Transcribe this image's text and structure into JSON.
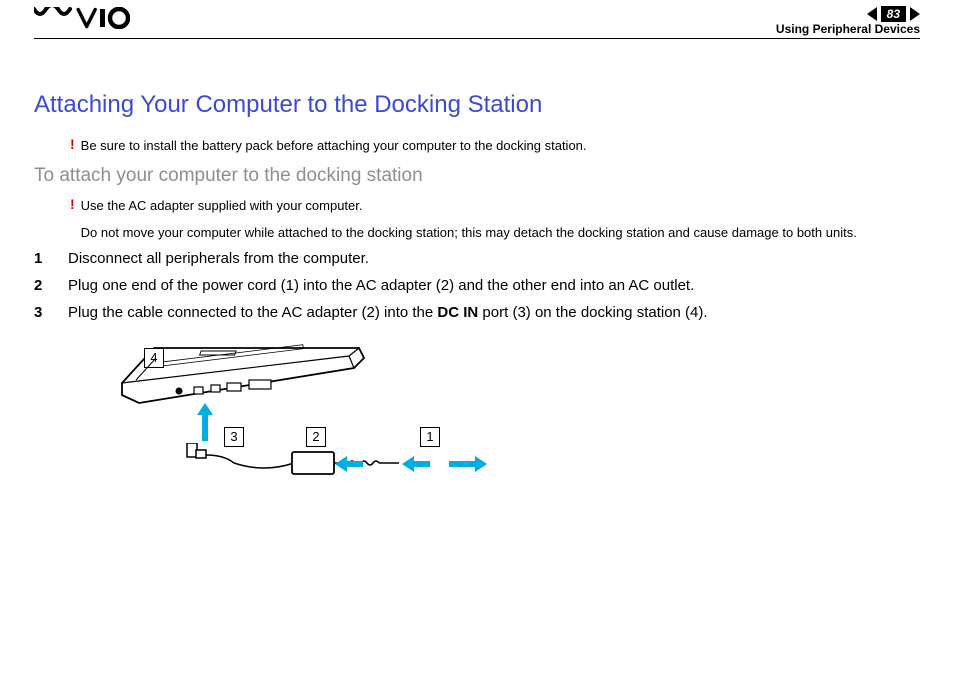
{
  "header": {
    "page_number": "83",
    "breadcrumb": "Using Peripheral Devices"
  },
  "title": "Attaching Your Computer to the Docking Station",
  "warn1": "Be sure to install the battery pack before attaching your computer to the docking station.",
  "subtitle": "To attach your computer to the docking station",
  "warn2_line1": "Use the AC adapter supplied with your computer.",
  "warn2_line2": "Do not move your computer while attached to the docking station; this may detach the docking station and cause damage to both units.",
  "steps": {
    "s1": {
      "n": "1",
      "text": "Disconnect all peripherals from the computer."
    },
    "s2": {
      "n": "2",
      "before": "Plug one end of the power cord (1) into the AC adapter (2) and the other end into an AC outlet."
    },
    "s3": {
      "n": "3",
      "before": "Plug the cable connected to the AC adapter (2) into the ",
      "bold": "DC IN",
      "after": " port (3) on the docking station (4)."
    }
  },
  "dia": {
    "c1": "1",
    "c2": "2",
    "c3": "3",
    "c4": "4"
  }
}
